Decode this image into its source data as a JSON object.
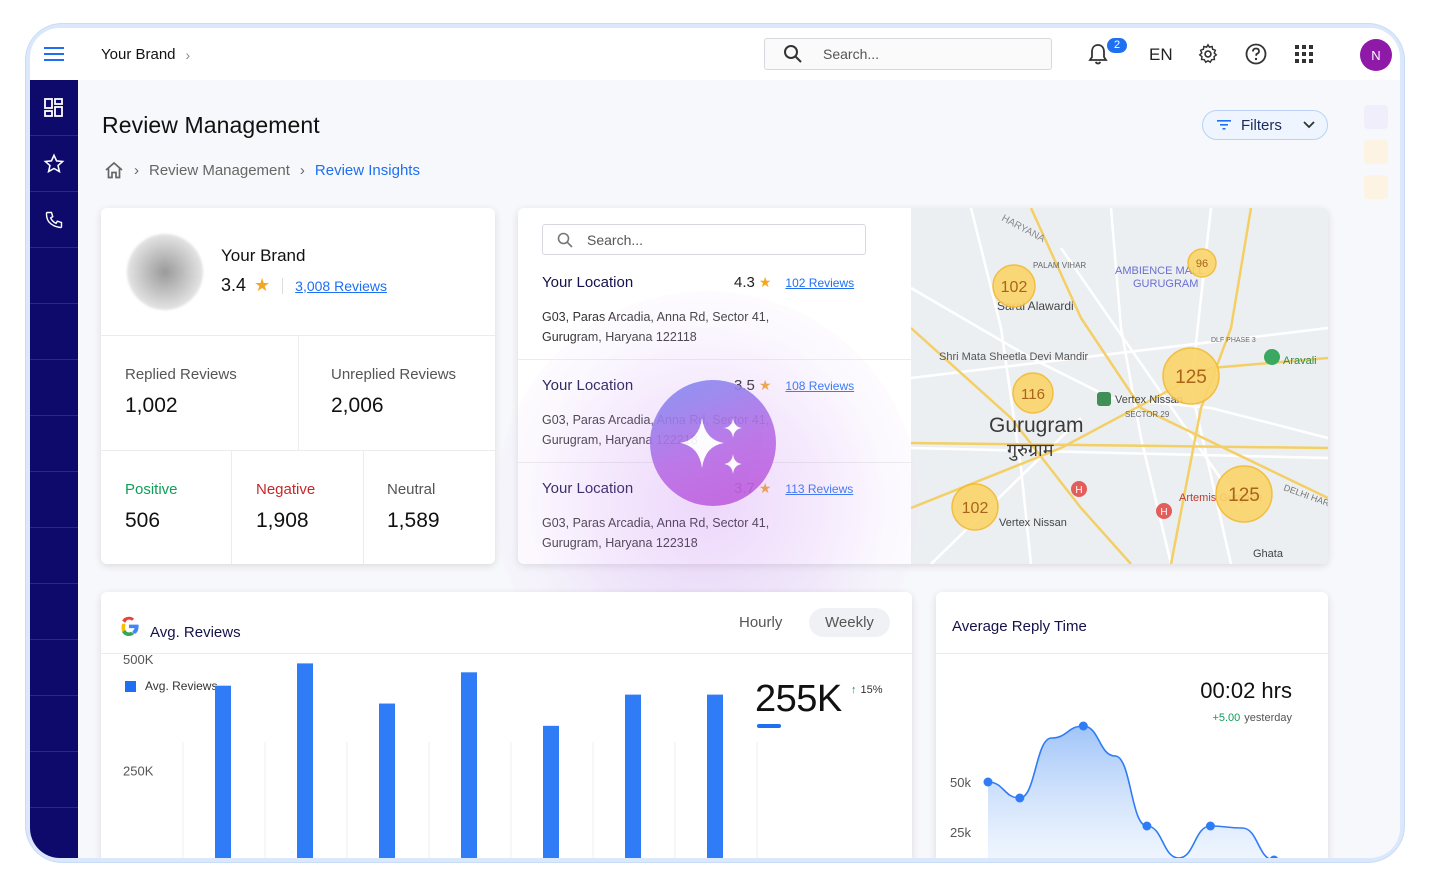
{
  "header": {
    "brand": "Your Brand",
    "search_placeholder": "Search...",
    "notification_count": "2",
    "language": "EN",
    "avatar_initial": "N"
  },
  "page": {
    "title": "Review Management",
    "breadcrumb": [
      "Review Management",
      "Review Insights"
    ],
    "filters_label": "Filters"
  },
  "brand_card": {
    "name": "Your Brand",
    "rating": "3.4",
    "reviews_link": "3,008 Reviews",
    "replied_label": "Replied Reviews",
    "replied_value": "1,002",
    "unreplied_label": "Unreplied Reviews",
    "unreplied_value": "2,006",
    "positive_label": "Positive",
    "positive_value": "506",
    "negative_label": "Negative",
    "negative_value": "1,908",
    "neutral_label": "Neutral",
    "neutral_value": "1,589",
    "colors": {
      "positive": "#0f9d58",
      "negative": "#c62828",
      "neutral": "#555555"
    }
  },
  "locations": {
    "search_placeholder": "Search...",
    "items": [
      {
        "name": "Your Location",
        "rating": "4.3",
        "reviews": "102 Reviews",
        "address_1": "G03, Paras Arcadia, Anna Rd, Sector 41,",
        "address_2": "Gurugram, Haryana 122118"
      },
      {
        "name": "Your Location",
        "rating": "3.5",
        "reviews": "108 Reviews",
        "address_1": "G03, Paras Arcadia, Anna Rd, Sector 41,",
        "address_2": "Gurugram, Haryana 122218"
      },
      {
        "name": "Your Location",
        "rating": "3.7",
        "reviews": "113 Reviews",
        "address_1": "G03, Paras Arcadia, Anna Rd, Sector 41,",
        "address_2": "Gurugram, Haryana 122318"
      }
    ]
  },
  "map": {
    "city": "Gurugram",
    "city_local": "गुरुग्राम",
    "clusters": [
      "102",
      "96",
      "125",
      "116",
      "125",
      "102"
    ],
    "labels": [
      "HARYANA",
      "PALAM VIHAR",
      "AMBIENCE MALL",
      "GURUGRAM",
      "Sarai Alawardi",
      "Shri Mata Sheetla Devi Mandir",
      "Vertex Nissan",
      "SECTOR 29",
      "Artemis Gurgaon",
      "Vertex Nissan",
      "Aravali",
      "DLF PHASE 3",
      "DELHI HARYANA",
      "Ghata"
    ]
  },
  "avg_reviews": {
    "title": "Avg. Reviews",
    "tabs": [
      "Hourly",
      "Weekly"
    ],
    "active_tab": "Weekly",
    "legend": "Avg. Reviews",
    "total": "255K",
    "change": "15%"
  },
  "reply_time": {
    "title": "Average Reply Time",
    "value": "00:02 hrs",
    "delta": "+5.00",
    "delta_suffix": "yesterday"
  },
  "chart_data": [
    {
      "type": "bar",
      "title": "Avg. Reviews",
      "series": [
        {
          "name": "Avg. Reviews",
          "values": [
            440,
            490,
            400,
            470,
            350,
            420,
            420
          ]
        }
      ],
      "categories": [
        "",
        "",
        "",
        "",
        "",
        "",
        ""
      ],
      "yticks": [
        "500K",
        "250K"
      ],
      "ylim": [
        0,
        650
      ],
      "color": "#2f7cf6"
    },
    {
      "type": "area",
      "title": "Average Reply Time",
      "x": [
        1,
        2,
        3,
        4,
        5,
        6,
        7,
        8,
        9,
        10
      ],
      "values": [
        50,
        42,
        72,
        78,
        63,
        28,
        12,
        28,
        27,
        11
      ],
      "marked": [
        1,
        2,
        4,
        6,
        8,
        10
      ],
      "yticks": [
        "50k",
        "25k"
      ],
      "ylim": [
        0,
        95
      ],
      "color": "#2f7cf6"
    }
  ],
  "colors": {
    "sidebar": "#0d0a6b",
    "accent": "#1e6ff2",
    "star": "#f5a623"
  }
}
